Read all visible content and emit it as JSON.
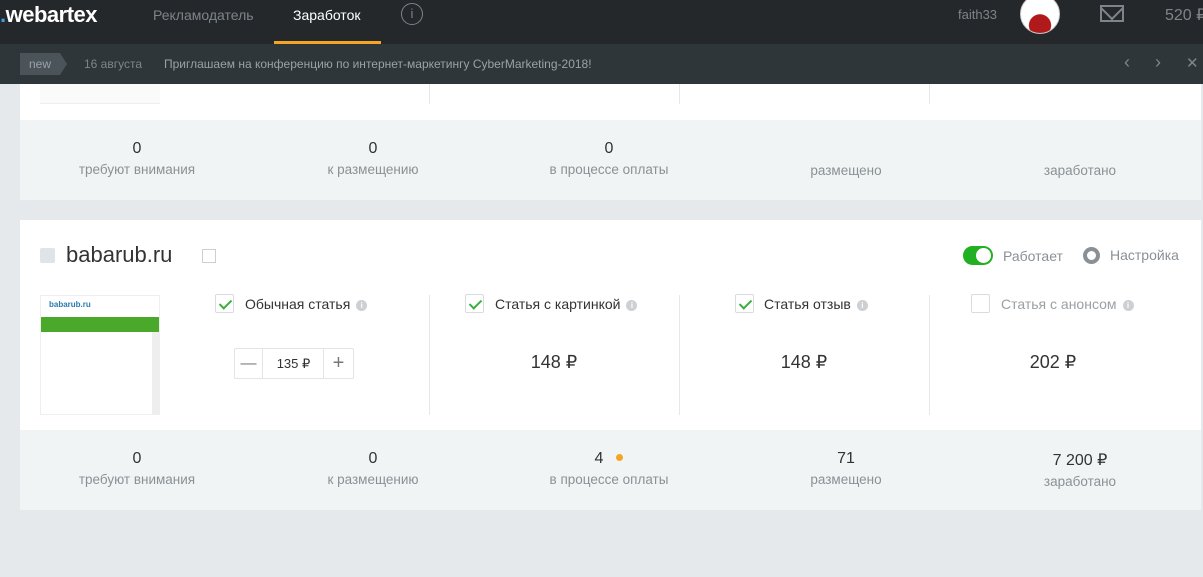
{
  "header": {
    "logo": "webartex",
    "nav": [
      "Рекламодатель",
      "Заработок"
    ],
    "info": "i",
    "username": "faith33",
    "balance": "520 ₽"
  },
  "news": {
    "badge": "new",
    "date": "16 августа",
    "text": "Приглашаем на конференцию по интернет-маркетингу CyberMarketing-2018!",
    "prev": "‹",
    "next": "›",
    "close": "✕"
  },
  "site1": {
    "stats": [
      {
        "value": "0",
        "label": "требуют внимания"
      },
      {
        "value": "0",
        "label": "к размещению"
      },
      {
        "value": "0",
        "label": "в процессе оплаты"
      },
      {
        "value": "",
        "label": "размещено"
      },
      {
        "value": "",
        "label": "заработано"
      }
    ]
  },
  "site2": {
    "name": "babarub.ru",
    "status": "Работает",
    "settings": "Настройка",
    "thumb_title": "babarub.ru",
    "options": [
      {
        "label": "Обычная статья",
        "checked": true,
        "price": "135 ₽"
      },
      {
        "label": "Статья с картинкой",
        "checked": true,
        "price": "148 ₽"
      },
      {
        "label": "Статья отзыв",
        "checked": true,
        "price": "148 ₽"
      },
      {
        "label": "Статья с анонсом",
        "checked": false,
        "price": "202 ₽"
      }
    ],
    "stepper": {
      "minus": "—",
      "plus": "+"
    },
    "stats": [
      {
        "value": "0",
        "label": "требуют внимания"
      },
      {
        "value": "0",
        "label": "к размещению"
      },
      {
        "value": "4",
        "label": "в процессе оплаты"
      },
      {
        "value": "71",
        "label": "размещено"
      },
      {
        "value": "7 200 ₽",
        "label": "заработано"
      }
    ]
  },
  "colors": {
    "accent": "#f4a623",
    "toggle": "#22b022",
    "dot": "#f4a623"
  }
}
